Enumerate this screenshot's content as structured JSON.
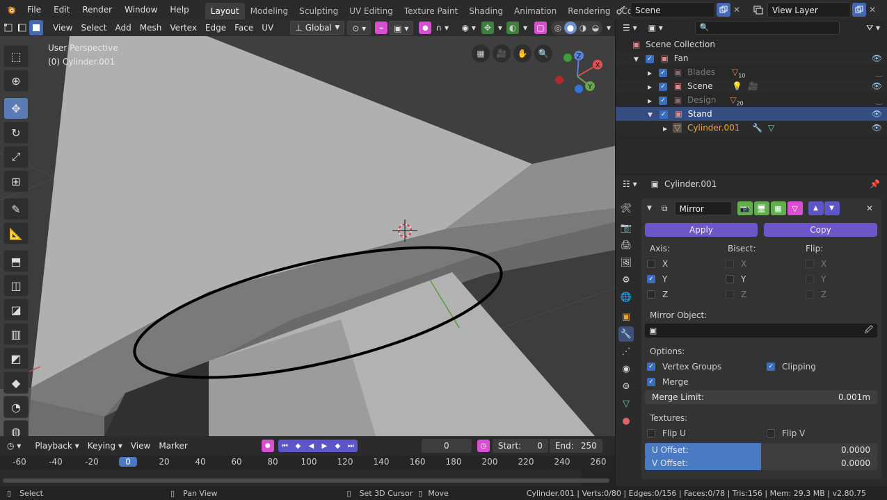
{
  "topbar": {
    "menus": [
      "File",
      "Edit",
      "Render",
      "Window",
      "Help"
    ],
    "workspaces": [
      "Layout",
      "Modeling",
      "Sculpting",
      "UV Editing",
      "Texture Paint",
      "Shading",
      "Animation",
      "Rendering",
      "Compositing"
    ],
    "active_workspace": "Layout",
    "scene_name": "Scene",
    "view_layer": "View Layer"
  },
  "viewport_header": {
    "menus": [
      "View",
      "Select",
      "Add",
      "Mesh",
      "Vertex",
      "Edge",
      "Face",
      "UV"
    ],
    "transform_orientation": "Global"
  },
  "viewport": {
    "perspective_label": "User Perspective",
    "object_label": "(0) Cylinder.001",
    "gizmo_axes": [
      "Z",
      "X",
      "Y"
    ]
  },
  "outliner": {
    "search_placeholder": "",
    "items": [
      {
        "label": "Scene Collection",
        "depth": 0
      },
      {
        "label": "Fan",
        "depth": 1
      },
      {
        "label": "Blades",
        "depth": 2,
        "badge": "10"
      },
      {
        "label": "Scene",
        "depth": 2
      },
      {
        "label": "Design",
        "depth": 2,
        "badge": "20"
      },
      {
        "label": "Stand",
        "depth": 2,
        "selected": true
      },
      {
        "label": "Cylinder.001",
        "depth": 3
      }
    ]
  },
  "properties": {
    "object_name": "Cylinder.001",
    "modifier": {
      "name": "Mirror",
      "apply_label": "Apply",
      "copy_label": "Copy",
      "axis_header": "Axis:",
      "bisect_header": "Bisect:",
      "flip_header": "Flip:",
      "axes": [
        "X",
        "Y",
        "Z"
      ],
      "axis_checked": [
        false,
        true,
        false
      ],
      "mirror_object_label": "Mirror Object:",
      "options_label": "Options:",
      "vertex_groups_label": "Vertex Groups",
      "vertex_groups_checked": true,
      "clipping_label": "Clipping",
      "clipping_checked": true,
      "merge_label": "Merge",
      "merge_checked": true,
      "merge_limit_label": "Merge Limit:",
      "merge_limit_value": "0.001m",
      "textures_label": "Textures:",
      "flip_u_label": "Flip U",
      "flip_v_label": "Flip V",
      "u_offset_label": "U Offset:",
      "u_offset_value": "0.0000",
      "v_offset_label": "V Offset:",
      "v_offset_value": "0.0000"
    }
  },
  "timeline": {
    "menus": [
      "Playback",
      "Keying",
      "View",
      "Marker"
    ],
    "current_frame": "0",
    "start_label": "Start:",
    "start_value": "0",
    "end_label": "End:",
    "end_value": "250",
    "ruler": [
      "-60",
      "-40",
      "-20",
      "0",
      "20",
      "40",
      "60",
      "80",
      "100",
      "120",
      "140",
      "160",
      "180",
      "200",
      "220",
      "240",
      "260"
    ]
  },
  "statusbar": {
    "select_hint": "Select",
    "pan_hint": "Pan View",
    "cursor_hint": "Set 3D Cursor",
    "move_hint": "Move",
    "stats": "Cylinder.001 | Verts:0/80 | Edges:0/156 | Faces:0/78 | Tris:156 | Mem: 29.3 MB | v2.80.75"
  },
  "colors": {
    "accent_blue": "#3b6fbe",
    "modifier_purple": "#6b57c8",
    "selected_row": "#334d80",
    "object_orange": "#f0a23a"
  }
}
